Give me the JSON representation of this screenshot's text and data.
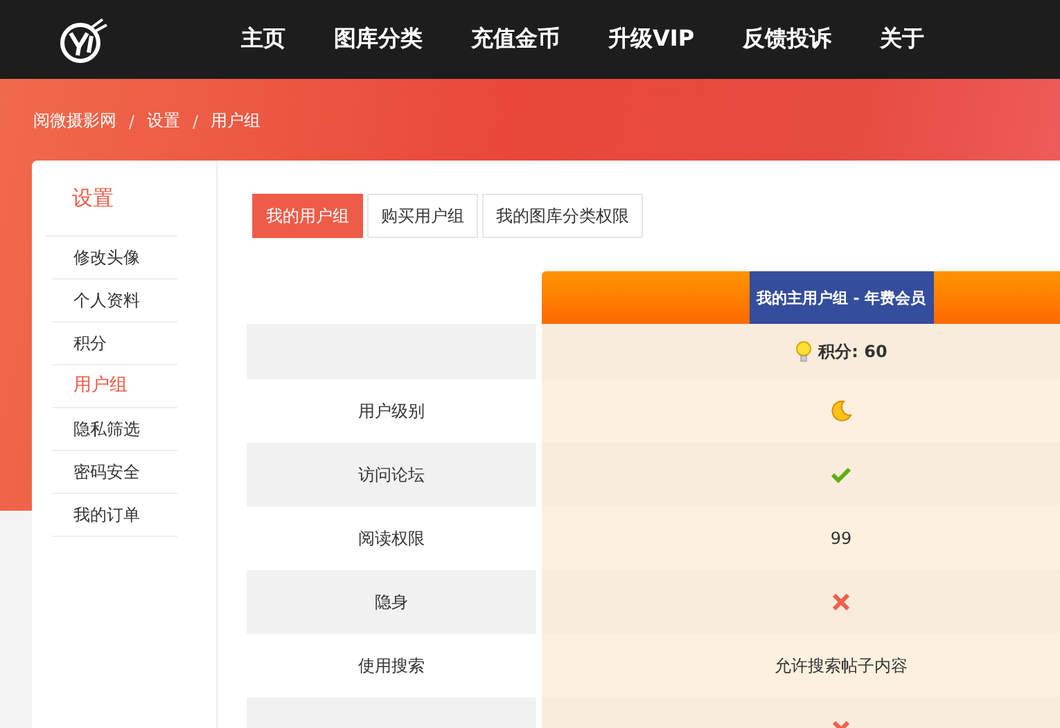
{
  "nav": {
    "items": [
      "主页",
      "图库分类",
      "充值金币",
      "升级VIP",
      "反馈投诉",
      "关于"
    ]
  },
  "breadcrumb": {
    "items": [
      "阅微摄影网",
      "设置",
      "用户组"
    ],
    "separator": "/"
  },
  "sidebar": {
    "title": "设置",
    "items": [
      {
        "label": "修改头像",
        "selected": false
      },
      {
        "label": "个人资料",
        "selected": false
      },
      {
        "label": "积分",
        "selected": false
      },
      {
        "label": "用户组",
        "selected": true
      },
      {
        "label": "隐私筛选",
        "selected": false
      },
      {
        "label": "密码安全",
        "selected": false
      },
      {
        "label": "我的订单",
        "selected": false
      }
    ]
  },
  "tabs": [
    {
      "label": "我的用户组",
      "selected": true
    },
    {
      "label": "购买用户组",
      "selected": false
    },
    {
      "label": "我的图库分类权限",
      "selected": false
    }
  ],
  "table": {
    "header": "我的主用户组 - 年费会员",
    "rows": [
      {
        "kind": "points",
        "text": "积分: 60"
      },
      {
        "kind": "moon",
        "label": "用户级别"
      },
      {
        "kind": "check",
        "label": "访问论坛"
      },
      {
        "kind": "text",
        "label": "阅读权限",
        "text": "99"
      },
      {
        "kind": "cross",
        "label": "隐身"
      },
      {
        "kind": "text",
        "label": "使用搜索",
        "text": "允许搜索帖子内容"
      },
      {
        "kind": "cross"
      }
    ]
  }
}
